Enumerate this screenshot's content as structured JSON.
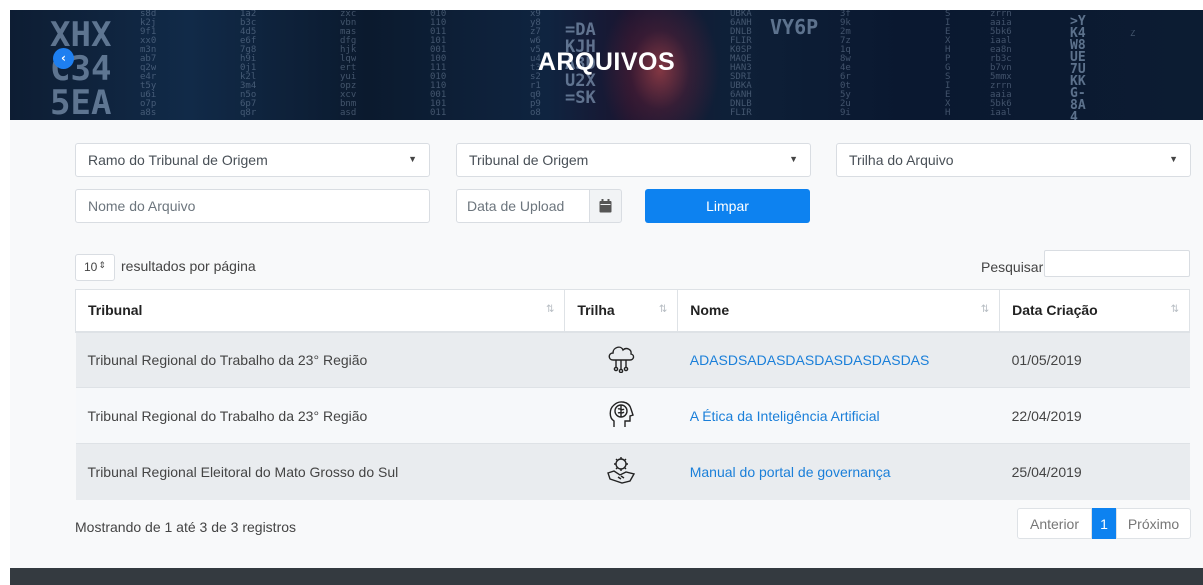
{
  "header": {
    "title": "ARQUIVOS",
    "back_icon": "chevron-left-icon"
  },
  "filters": {
    "ramo_label": "Ramo do Tribunal de Origem",
    "tribunal_label": "Tribunal de Origem",
    "trilha_label": "Trilha do Arquivo",
    "nome_placeholder": "Nome do Arquivo",
    "data_placeholder": "Data de Upload",
    "calendar_icon": "calendar-icon",
    "clear_label": "Limpar"
  },
  "table_controls": {
    "page_length": "10",
    "length_suffix": "resultados por página",
    "search_label": "Pesquisar"
  },
  "table": {
    "columns": [
      "Tribunal",
      "Trilha",
      "Nome",
      "Data Criação"
    ],
    "rows": [
      {
        "tribunal": "Tribunal Regional do Trabalho da 23° Região",
        "trilha_icon": "cloud-network-icon",
        "nome": "ADASDSADASDASDASDASDASDAS",
        "data": "01/05/2019"
      },
      {
        "tribunal": "Tribunal Regional do Trabalho da 23° Região",
        "trilha_icon": "brain-head-icon",
        "nome": "A Ética da Inteligência Artificial",
        "data": "22/04/2019"
      },
      {
        "tribunal": "Tribunal Regional Eleitoral do Mato Grosso do Sul",
        "trilha_icon": "handshake-gear-icon",
        "nome": "Manual do portal de governança",
        "data": "25/04/2019"
      }
    ]
  },
  "footer_info": "Mostrando de 1 até 3 de 3 registros",
  "pagination": {
    "previous": "Anterior",
    "current": "1",
    "next": "Próximo"
  },
  "colors": {
    "primary": "#0d82f0",
    "link": "#1a7fd9",
    "footer": "#343a40"
  }
}
